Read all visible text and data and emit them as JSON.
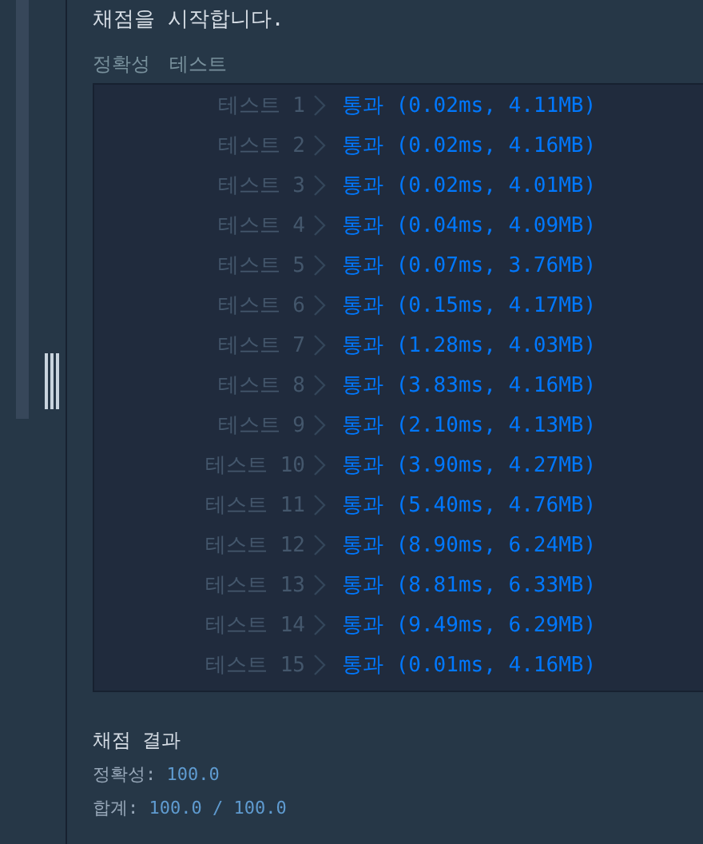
{
  "heading": "채점을 시작합니다.",
  "result_header": [
    "정확성",
    "테스트"
  ],
  "tests": [
    {
      "label": "테스트 1",
      "kind": "pass",
      "status": "통과",
      "detail": "(0.02ms, 4.11MB)"
    },
    {
      "label": "테스트 2",
      "kind": "pass",
      "status": "통과",
      "detail": "(0.02ms, 4.16MB)"
    },
    {
      "label": "테스트 3",
      "kind": "pass",
      "status": "통과",
      "detail": "(0.02ms, 4.01MB)"
    },
    {
      "label": "테스트 4",
      "kind": "pass",
      "status": "통과",
      "detail": "(0.04ms, 4.09MB)"
    },
    {
      "label": "테스트 5",
      "kind": "pass",
      "status": "통과",
      "detail": "(0.07ms, 3.76MB)"
    },
    {
      "label": "테스트 6",
      "kind": "pass",
      "status": "통과",
      "detail": "(0.15ms, 4.17MB)"
    },
    {
      "label": "테스트 7",
      "kind": "pass",
      "status": "통과",
      "detail": "(1.28ms, 4.03MB)"
    },
    {
      "label": "테스트 8",
      "kind": "pass",
      "status": "통과",
      "detail": "(3.83ms, 4.16MB)"
    },
    {
      "label": "테스트 9",
      "kind": "pass",
      "status": "통과",
      "detail": "(2.10ms, 4.13MB)"
    },
    {
      "label": "테스트 10",
      "kind": "pass",
      "status": "통과",
      "detail": "(3.90ms, 4.27MB)"
    },
    {
      "label": "테스트 11",
      "kind": "pass",
      "status": "통과",
      "detail": "(5.40ms, 4.76MB)"
    },
    {
      "label": "테스트 12",
      "kind": "pass",
      "status": "통과",
      "detail": "(8.90ms, 6.24MB)"
    },
    {
      "label": "테스트 13",
      "kind": "pass",
      "status": "통과",
      "detail": "(8.81ms, 6.33MB)"
    },
    {
      "label": "테스트 14",
      "kind": "pass",
      "status": "통과",
      "detail": "(9.49ms, 6.29MB)"
    },
    {
      "label": "테스트 15",
      "kind": "pass",
      "status": "통과",
      "detail": "(0.01ms, 4.16MB)"
    }
  ],
  "summary": {
    "title": "채점 결과",
    "lines": [
      {
        "label": "정확성:",
        "value": "100.0"
      },
      {
        "label": "합계:",
        "value": "100.0 / 100.0"
      }
    ]
  }
}
